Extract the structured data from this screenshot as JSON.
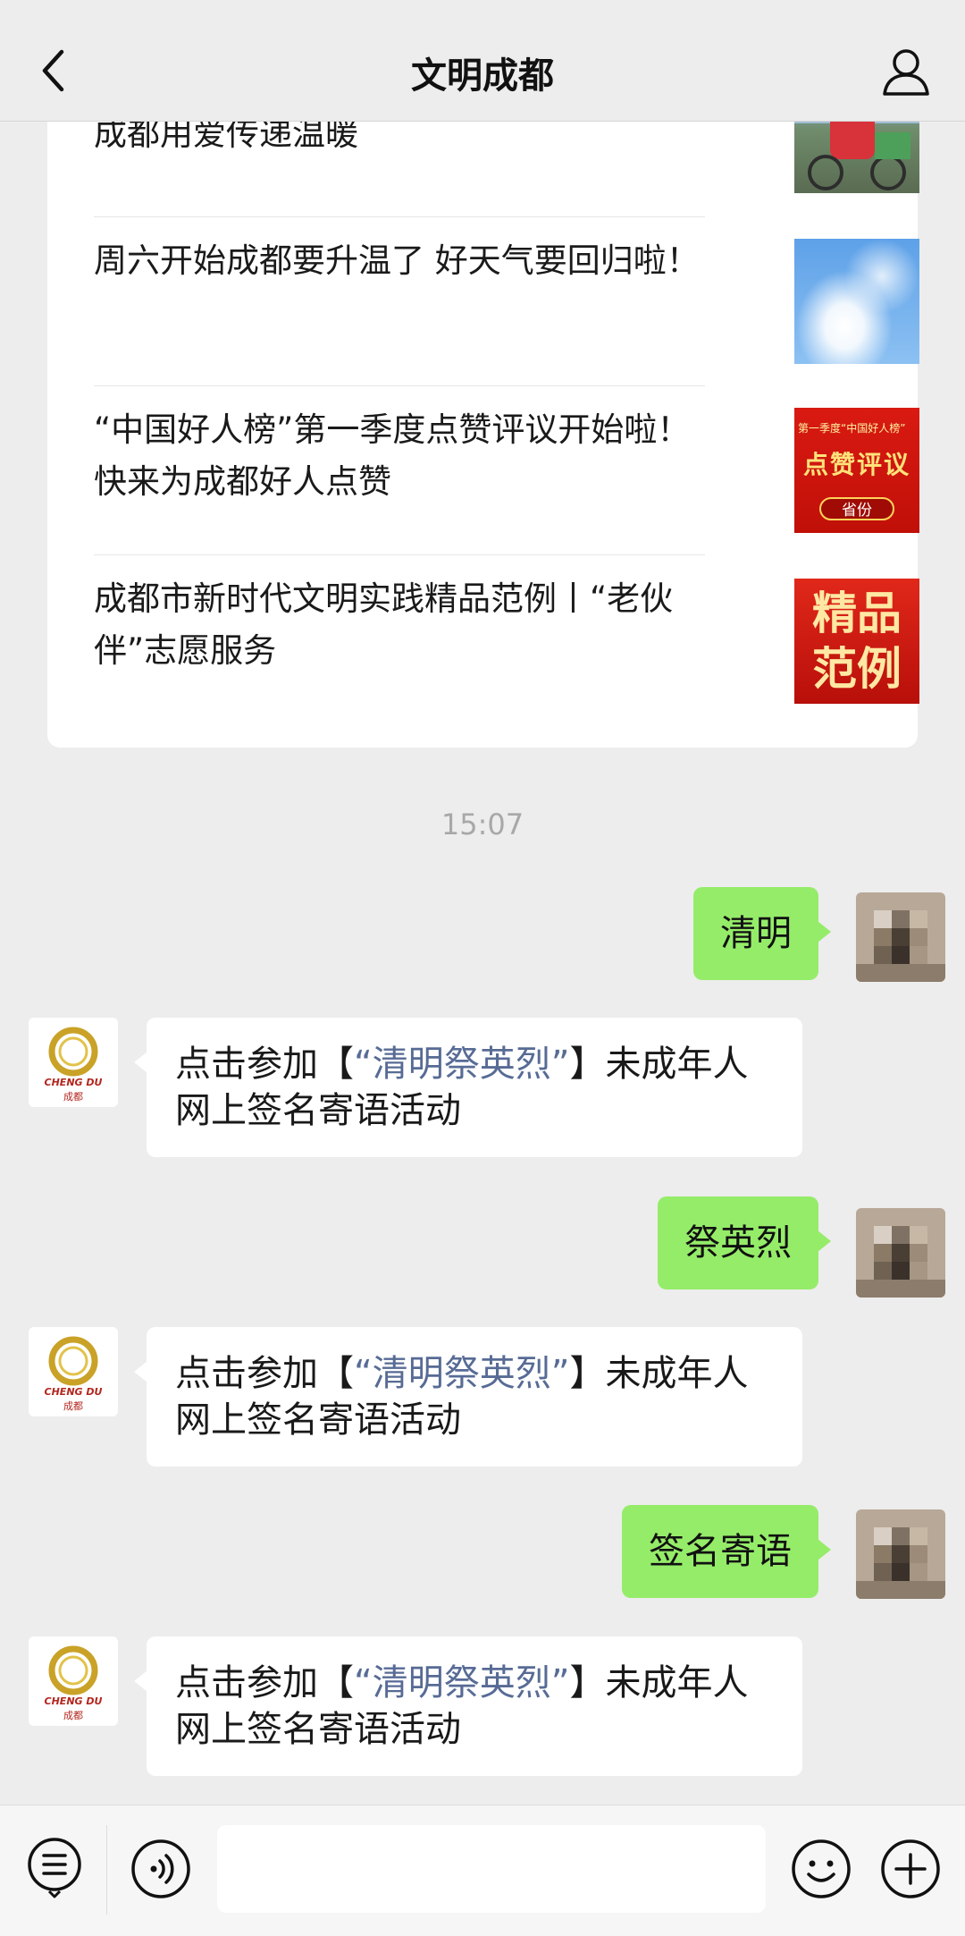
{
  "header": {
    "title": "文明成都"
  },
  "articles": [
    {
      "title": "成都用爱传递温暖",
      "thumb": "cyclist-photo"
    },
    {
      "title": "周六开始成都要升温了 好天气要回归啦！",
      "thumb": "blue-sky-photo"
    },
    {
      "title": "“中国好人榜”第一季度点赞评议开始啦！快来为成都好人点赞",
      "thumb": "red-banner-image",
      "thumb_text_top": "第一季度“中国好人榜”",
      "thumb_text_main": "点赞评议",
      "thumb_text_tag": "省份"
    },
    {
      "title": "成都市新时代文明实践精品范例丨“老伙伴”志愿服务",
      "thumb": "red-badge-image",
      "thumb_text": "精品范例"
    }
  ],
  "timestamp": "15:07",
  "messages": [
    {
      "direction": "out",
      "text": "清明"
    },
    {
      "direction": "in",
      "pre": "点击参加【",
      "link": "“清明祭英烈”",
      "post": "】未成年人网上签名寄语活动"
    },
    {
      "direction": "out",
      "text": "祭英烈"
    },
    {
      "direction": "in",
      "pre": "点击参加【",
      "link": "“清明祭英烈”",
      "post": "】未成年人网上签名寄语活动"
    },
    {
      "direction": "out",
      "text": "签名寄语"
    },
    {
      "direction": "in",
      "pre": "点击参加【",
      "link": "“清明祭英烈”",
      "post": "】未成年人网上签名寄语活动"
    }
  ],
  "bot_avatar": {
    "logo_text": "CHENG DU",
    "logo_sub": "成都"
  },
  "colors": {
    "background": "#ededed",
    "outgoing_bubble": "#95ec69",
    "incoming_bubble": "#ffffff",
    "link": "#576b95",
    "timestamp": "#a8a8a8"
  },
  "icons": [
    "back-arrow-icon",
    "profile-icon",
    "menu-list-icon",
    "voice-icon",
    "emoji-icon",
    "plus-icon"
  ]
}
